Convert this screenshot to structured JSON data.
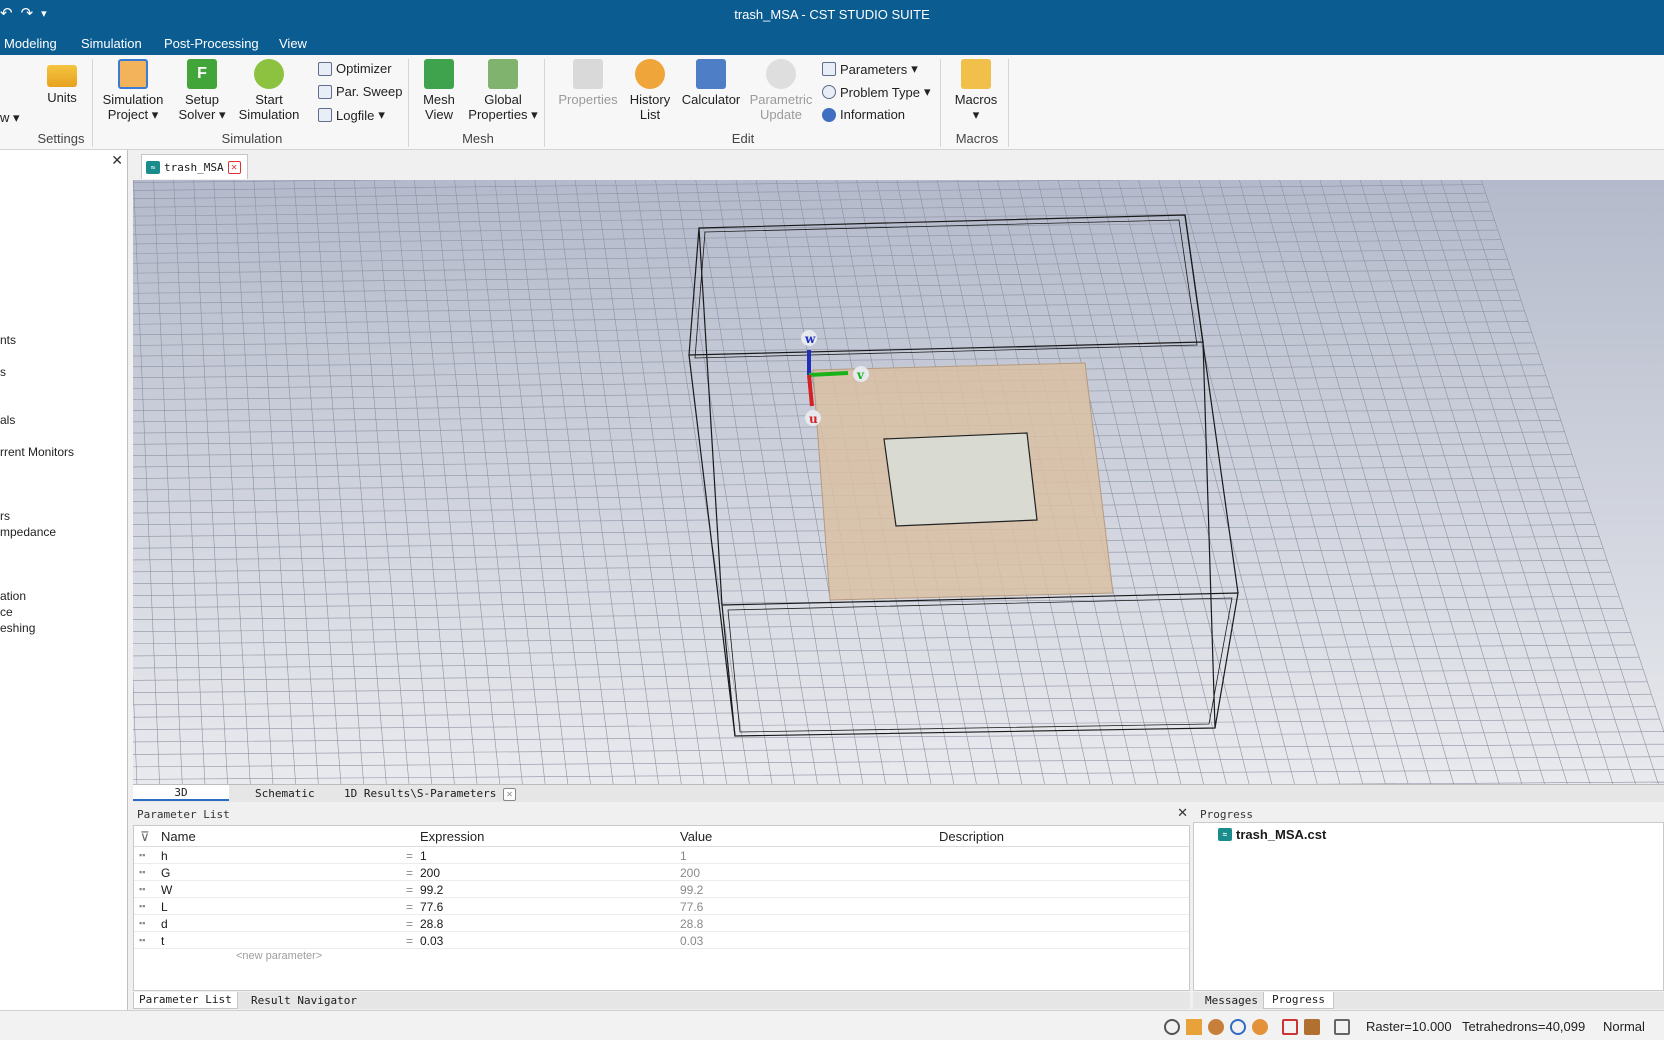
{
  "window": {
    "title": "trash_MSA - CST STUDIO SUITE",
    "undo_icon": "undo-icon",
    "redo_icon": "redo-icon",
    "customize_icon": "dropdown-icon"
  },
  "menu": [
    "Modeling",
    "Simulation",
    "Post-Processing",
    "View"
  ],
  "ribbon": {
    "view_fragment": "w",
    "units": "Units",
    "simulation_project": [
      "Simulation",
      "Project"
    ],
    "setup_solver": [
      "Setup",
      "Solver"
    ],
    "start_simulation": [
      "Start",
      "Simulation"
    ],
    "optimizer": "Optimizer",
    "par_sweep": "Par. Sweep",
    "logfile": "Logfile",
    "mesh_view": [
      "Mesh",
      "View"
    ],
    "global_properties": [
      "Global",
      "Properties"
    ],
    "properties": "Properties",
    "history_list": [
      "History",
      "List"
    ],
    "calculator": "Calculator",
    "parametric_update": [
      "Parametric",
      "Update"
    ],
    "parameters": "Parameters",
    "problem_type": "Problem Type",
    "information": "Information",
    "macros": "Macros",
    "groups": [
      "Settings",
      "Simulation",
      "Mesh",
      "Edit",
      "Macros"
    ]
  },
  "left_panel": {
    "close": "✕",
    "items": [
      "nts",
      "s",
      "als",
      "rrent Monitors",
      "rs",
      "mpedance",
      "ation",
      "ce",
      "eshing"
    ]
  },
  "document_tab": {
    "label": "trash_MSA",
    "close": "✕"
  },
  "viewport": {
    "axes": {
      "w": "w",
      "v": "v",
      "u": "u"
    },
    "colors": {
      "background_top": "#b3b9c9",
      "background_bottom": "#e9eaee",
      "substrate": "#d9bfa3",
      "patch": "#d9dbd2",
      "axis_w": "#1f2fb8",
      "axis_v": "#19b319",
      "axis_u": "#d42020"
    }
  },
  "view_tabs": [
    "3D",
    "Schematic",
    "1D Results\\S-Parameters"
  ],
  "parameter_list": {
    "title": "Parameter List",
    "close": "✕",
    "columns": [
      "Name",
      "Expression",
      "Value",
      "Description"
    ],
    "rows": [
      {
        "name": "h",
        "expression": "1",
        "value": "1"
      },
      {
        "name": "G",
        "expression": "200",
        "value": "200"
      },
      {
        "name": "W",
        "expression": "99.2",
        "value": "99.2"
      },
      {
        "name": "L",
        "expression": "77.6",
        "value": "77.6"
      },
      {
        "name": "d",
        "expression": "28.8",
        "value": "28.8"
      },
      {
        "name": "t",
        "expression": "0.03",
        "value": "0.03"
      }
    ],
    "new_parameter": "<new parameter>",
    "tabs": [
      "Parameter List",
      "Result Navigator"
    ]
  },
  "progress": {
    "title": "Progress",
    "file": "trash_MSA.cst",
    "tabs": [
      "Messages",
      "Progress"
    ]
  },
  "status": {
    "raster": "Raster=10.000",
    "tetrahedrons": "Tetrahedrons=40,099",
    "mode": "Normal"
  }
}
